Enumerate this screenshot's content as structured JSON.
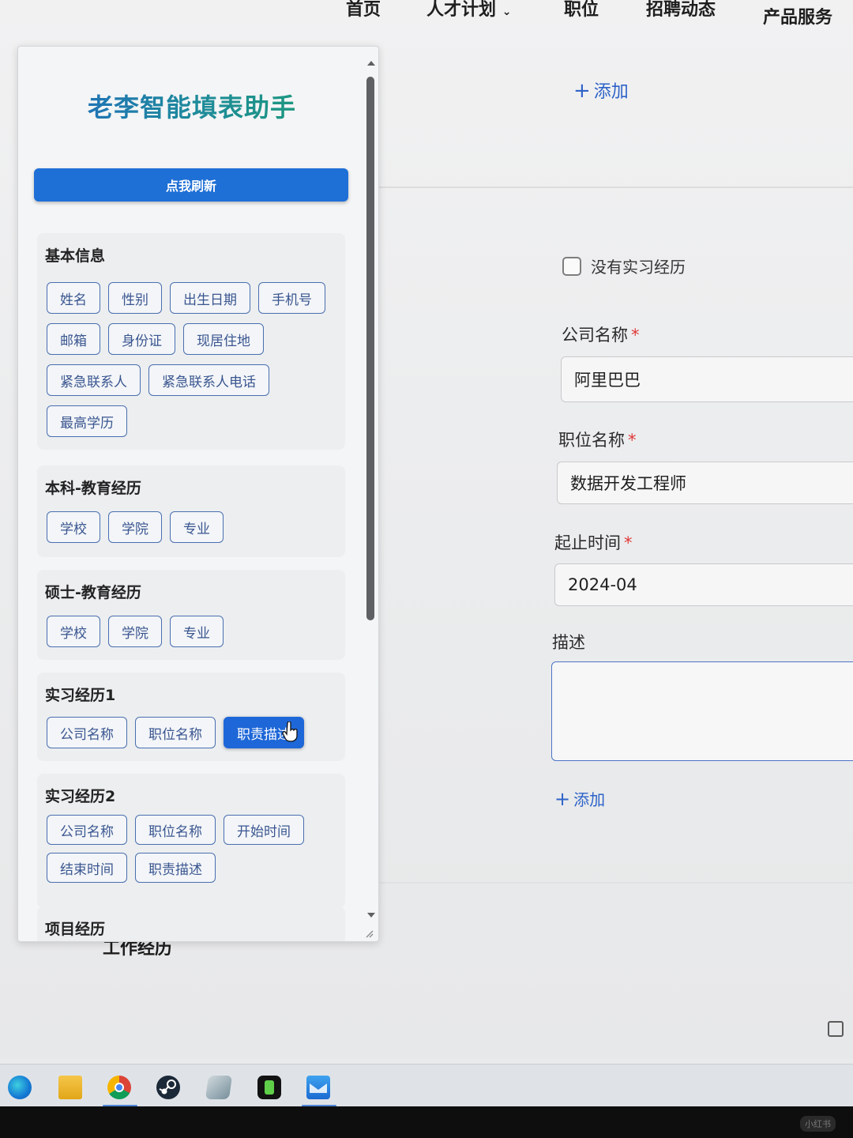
{
  "nav": {
    "items": [
      "首页",
      "人才计划",
      "职位",
      "招聘动态",
      "产品服务"
    ]
  },
  "form": {
    "add_top_label": "添加",
    "no_internship_label": "没有实习经历",
    "company_label": "公司名称",
    "company_value": "阿里巴巴",
    "position_label": "职位名称",
    "position_value": "数据开发工程师",
    "period_label": "起止时间",
    "period_value": "2024-04",
    "description_label": "描述",
    "add_bottom_label": "添加",
    "required_mark": "*",
    "lower_heading": "工作经历"
  },
  "panel": {
    "title": "老李智能填表助手",
    "refresh_label": "点我刷新",
    "sections": [
      {
        "title": "基本信息",
        "chips": [
          "姓名",
          "性别",
          "出生日期",
          "手机号",
          "邮箱",
          "身份证",
          "现居住地",
          "紧急联系人",
          "紧急联系人电话",
          "最高学历"
        ]
      },
      {
        "title": "本科-教育经历",
        "chips": [
          "学校",
          "学院",
          "专业"
        ]
      },
      {
        "title": "硕士-教育经历",
        "chips": [
          "学校",
          "学院",
          "专业"
        ]
      },
      {
        "title": "实习经历1",
        "chips": [
          "公司名称",
          "职位名称",
          "职责描述"
        ],
        "active_chip": "职责描述"
      },
      {
        "title": "实习经历2",
        "chips": [
          "公司名称",
          "职位名称",
          "开始时间",
          "结束时间",
          "职责描述"
        ]
      },
      {
        "title": "项目经历",
        "chips": []
      }
    ]
  },
  "taskbar": {
    "apps": [
      "edge-icon",
      "file-explorer-icon",
      "chrome-icon",
      "steam-icon",
      "app-icon",
      "game-icon",
      "mail-icon"
    ]
  },
  "watermark": "小红书",
  "colors": {
    "accent": "#1e6fd6",
    "link": "#2d63c8",
    "required": "#e0393b",
    "chip_border": "#4a6fb0"
  }
}
